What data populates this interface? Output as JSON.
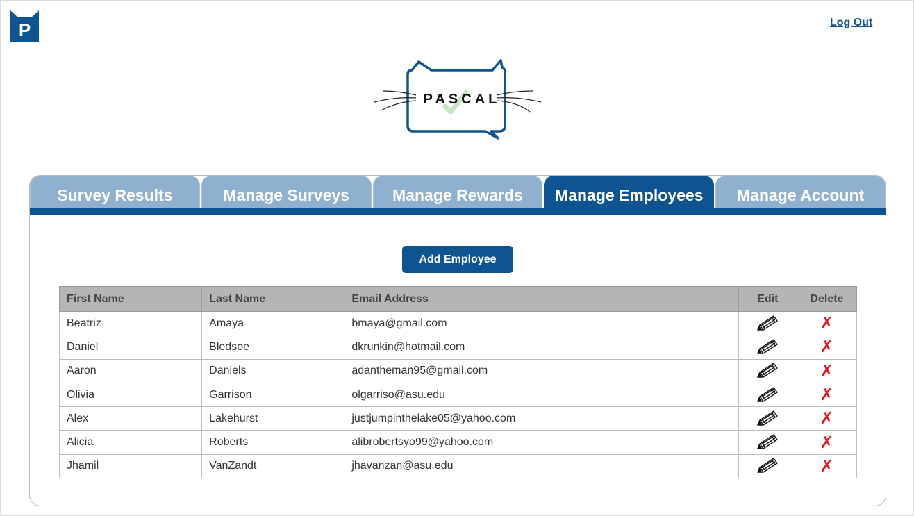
{
  "header": {
    "app_logo_letter": "P",
    "brand_name": "PASCAL",
    "logout_label": "Log Out"
  },
  "tabs": [
    {
      "label": "Survey Results",
      "active": false
    },
    {
      "label": "Manage Surveys",
      "active": false
    },
    {
      "label": "Manage Rewards",
      "active": false
    },
    {
      "label": "Manage Employees",
      "active": true
    },
    {
      "label": "Manage Account",
      "active": false
    }
  ],
  "actions": {
    "add_employee_label": "Add Employee"
  },
  "table": {
    "columns": [
      "First Name",
      "Last Name",
      "Email Address",
      "Edit",
      "Delete"
    ],
    "rows": [
      {
        "first": "Beatriz",
        "last": "Amaya",
        "email": "bmaya@gmail.com"
      },
      {
        "first": "Daniel",
        "last": "Bledsoe",
        "email": "dkrunkin@hotmail.com"
      },
      {
        "first": "Aaron",
        "last": "Daniels",
        "email": "adantheman95@gmail.com"
      },
      {
        "first": "Olivia",
        "last": "Garrison",
        "email": "olgarriso@asu.edu"
      },
      {
        "first": "Alex",
        "last": "Lakehurst",
        "email": "justjumpinthelake05@yahoo.com"
      },
      {
        "first": "Alicia",
        "last": "Roberts",
        "email": "alibrobertsyo99@yahoo.com"
      },
      {
        "first": "Jhamil",
        "last": "VanZandt",
        "email": "jhavanzan@asu.edu"
      }
    ],
    "edit_icon": "pencil-icon",
    "delete_icon": "red-x-icon",
    "delete_glyph": "✗"
  },
  "colors": {
    "brand": "#0d5491",
    "tab_inactive": "#8fb0cf",
    "delete": "#e8141b",
    "header_row": "#b5b5b5"
  }
}
